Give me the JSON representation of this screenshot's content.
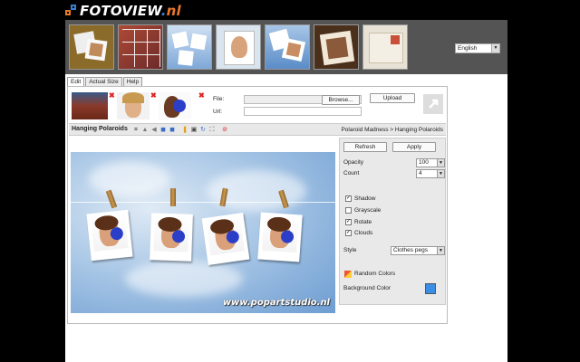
{
  "logo": {
    "text": "FOTOVIEW",
    "dot": ".",
    "tld": "nl"
  },
  "header": {
    "language": "English",
    "thumbnails": [
      "template-polaroid-stack",
      "template-puzzle",
      "template-sky-grid",
      "template-portrait-frame",
      "template-shattered-polaroids",
      "template-sepia-frame",
      "template-postcard"
    ]
  },
  "tabs": [
    {
      "label": "Edit",
      "active": true
    },
    {
      "label": "Actual Size",
      "active": false
    },
    {
      "label": "Help",
      "active": false
    }
  ],
  "upload": {
    "file_label": "File:",
    "url_label": "Url:",
    "browse_label": "Browse...",
    "upload_label": "Upload"
  },
  "toolbar": {
    "title": "Hanging Polaroids",
    "breadcrumb": "Polaroid Madness > Hanging Polaroids"
  },
  "canvas": {
    "watermark": "www.popartstudio.nl"
  },
  "options": {
    "refresh_label": "Refresh",
    "apply_label": "Apply",
    "opacity_label": "Opacity",
    "opacity_value": "100",
    "count_label": "Count",
    "count_value": "4",
    "shadow_label": "Shadow",
    "shadow_checked": true,
    "grayscale_label": "Grayscale",
    "grayscale_checked": false,
    "rotate_label": "Rotate",
    "rotate_checked": true,
    "clouds_label": "Clouds",
    "clouds_checked": true,
    "style_label": "Style",
    "style_value": "Clothes pegs",
    "random_colors_label": "Random Colors",
    "background_color_label": "Background Color",
    "background_color": "#3a8ee6"
  }
}
